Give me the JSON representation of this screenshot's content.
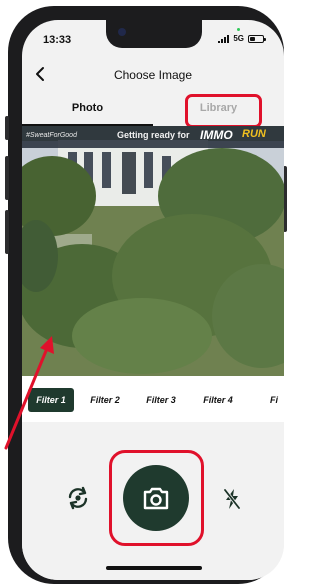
{
  "status_bar": {
    "time": "13:33",
    "network": "5G",
    "battery_percent": 45
  },
  "header": {
    "title": "Choose Image",
    "back_icon": "chevron-left-icon"
  },
  "tabs": [
    {
      "label": "Photo",
      "selected": true
    },
    {
      "label": "Library",
      "selected": false
    }
  ],
  "preview": {
    "banner_hashtag": "#SweatForGood",
    "banner_text": "Getting ready for",
    "banner_logo": "IMMO",
    "banner_logo_accent": "RUN"
  },
  "filters": [
    {
      "label": "Filter 1",
      "selected": true
    },
    {
      "label": "Filter 2",
      "selected": false
    },
    {
      "label": "Filter 3",
      "selected": false
    },
    {
      "label": "Filter 4",
      "selected": false
    },
    {
      "label": "Fi",
      "selected": false
    }
  ],
  "controls": {
    "flip_icon": "flip-camera-icon",
    "capture_icon": "camera-icon",
    "flash_icon": "flash-off-icon"
  },
  "colors": {
    "accent": "#1f3a2e",
    "highlight": "#e0112b",
    "inactive_tab": "#a8a8a8"
  }
}
